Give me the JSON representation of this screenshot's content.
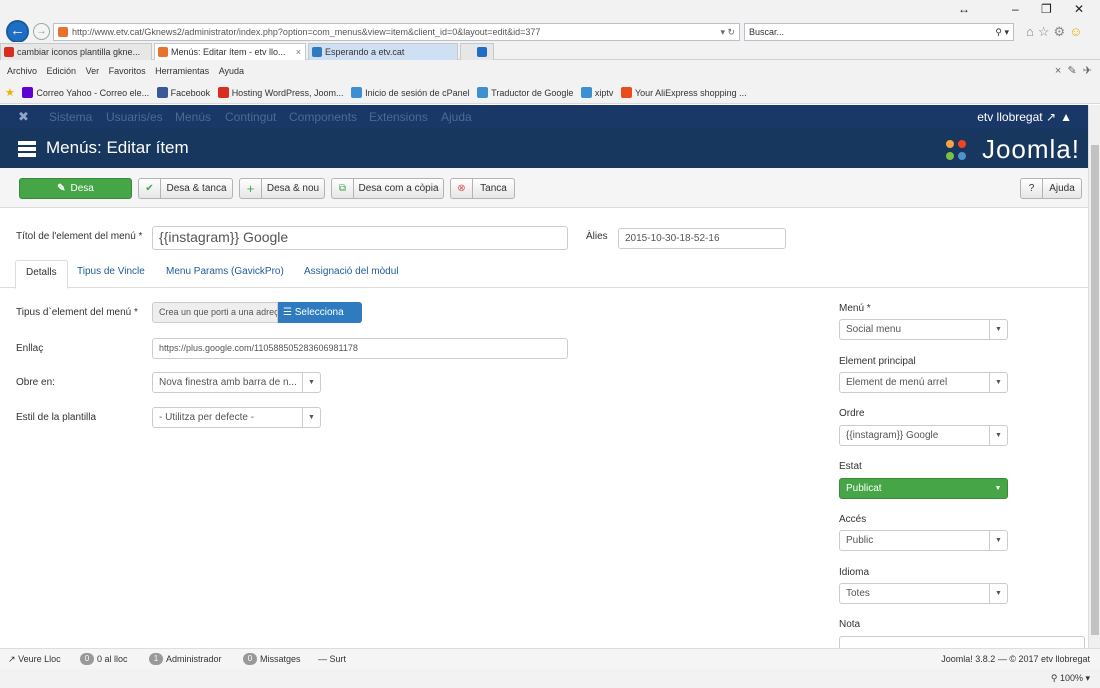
{
  "browser": {
    "address": "http://www.etv.cat/Gknews2/administrator/index.php?option=com_menus&view=item&client_id=0&layout=edit&id=377",
    "search_placeholder": "Buscar...",
    "tabs": [
      {
        "label": "cambiar iconos plantilla gkne..."
      },
      {
        "label": "Menús: Editar ítem - etv llo..."
      },
      {
        "label": "Esperando a etv.cat"
      }
    ],
    "menu": [
      "Archivo",
      "Edición",
      "Ver",
      "Favoritos",
      "Herramientas",
      "Ayuda"
    ],
    "favorites": [
      {
        "label": "Correo Yahoo - Correo ele...",
        "color": "#5f01d1"
      },
      {
        "label": "Facebook",
        "color": "#3b5998"
      },
      {
        "label": "Hosting WordPress, Joom...",
        "color": "#d62d20"
      },
      {
        "label": "Inicio de sesión de cPanel",
        "color": "#3d8fd1"
      },
      {
        "label": "Traductor de Google",
        "color": "#3d8fd1"
      },
      {
        "label": "xiptv",
        "color": "#3d8fd1"
      },
      {
        "label": "Your AliExpress shopping ...",
        "color": "#e84c1d"
      }
    ],
    "zoom": "100%"
  },
  "joomla_nav": {
    "items": [
      "Sistema",
      "Usuaris/es",
      "Menús",
      "Contingut",
      "Components",
      "Extensions",
      "Ajuda"
    ],
    "user": "etv llobregat"
  },
  "header": {
    "title": "Menús: Editar ítem",
    "logo": "Joomla!"
  },
  "toolbar": {
    "save": "Desa",
    "save_close": "Desa & tanca",
    "save_new": "Desa & nou",
    "save_copy": "Desa com a còpia",
    "close": "Tanca",
    "help": "Ajuda"
  },
  "form": {
    "title_label": "Títol de l'element del menú *",
    "title_value": "{{instagram}} Google",
    "alias_label": "Àlies",
    "alias_value": "2015-10-30-18-52-16",
    "tabs": [
      "Detalls",
      "Tipus de Vincle",
      "Menu Params (GavickPro)",
      "Assignació del mòdul"
    ],
    "type_label": "Tipus d`element del menú *",
    "type_value": "Crea un que porti a una adreça",
    "select_button": "Selecciona",
    "link_label": "Enllaç",
    "link_value": "https://plus.google.com/110588505283606981178",
    "target_label": "Obre en:",
    "target_value": "Nova finestra amb barra de n...",
    "template_label": "Estil de la plantilla",
    "template_value": "- Utilitza per defecte -"
  },
  "sidebar": {
    "menu_label": "Menú *",
    "menu_value": "Social menu",
    "parent_label": "Element principal",
    "parent_value": "Element de menú arrel",
    "order_label": "Ordre",
    "order_value": "{{instagram}} Google",
    "status_label": "Estat",
    "status_value": "Publicat",
    "access_label": "Accés",
    "access_value": "Public",
    "language_label": "Idioma",
    "language_value": "Totes",
    "note_label": "Nota"
  },
  "statusbar": {
    "view_site": "Veure Lloc",
    "visitors_count": "0",
    "visitors_label": "0 al lloc",
    "admins_count": "1",
    "admins_label": "Administrador",
    "messages_count": "0",
    "messages_label": "Missatges",
    "logout": "Surt",
    "version": "Joomla! 3.8.2 — © 2017 etv llobregat"
  }
}
